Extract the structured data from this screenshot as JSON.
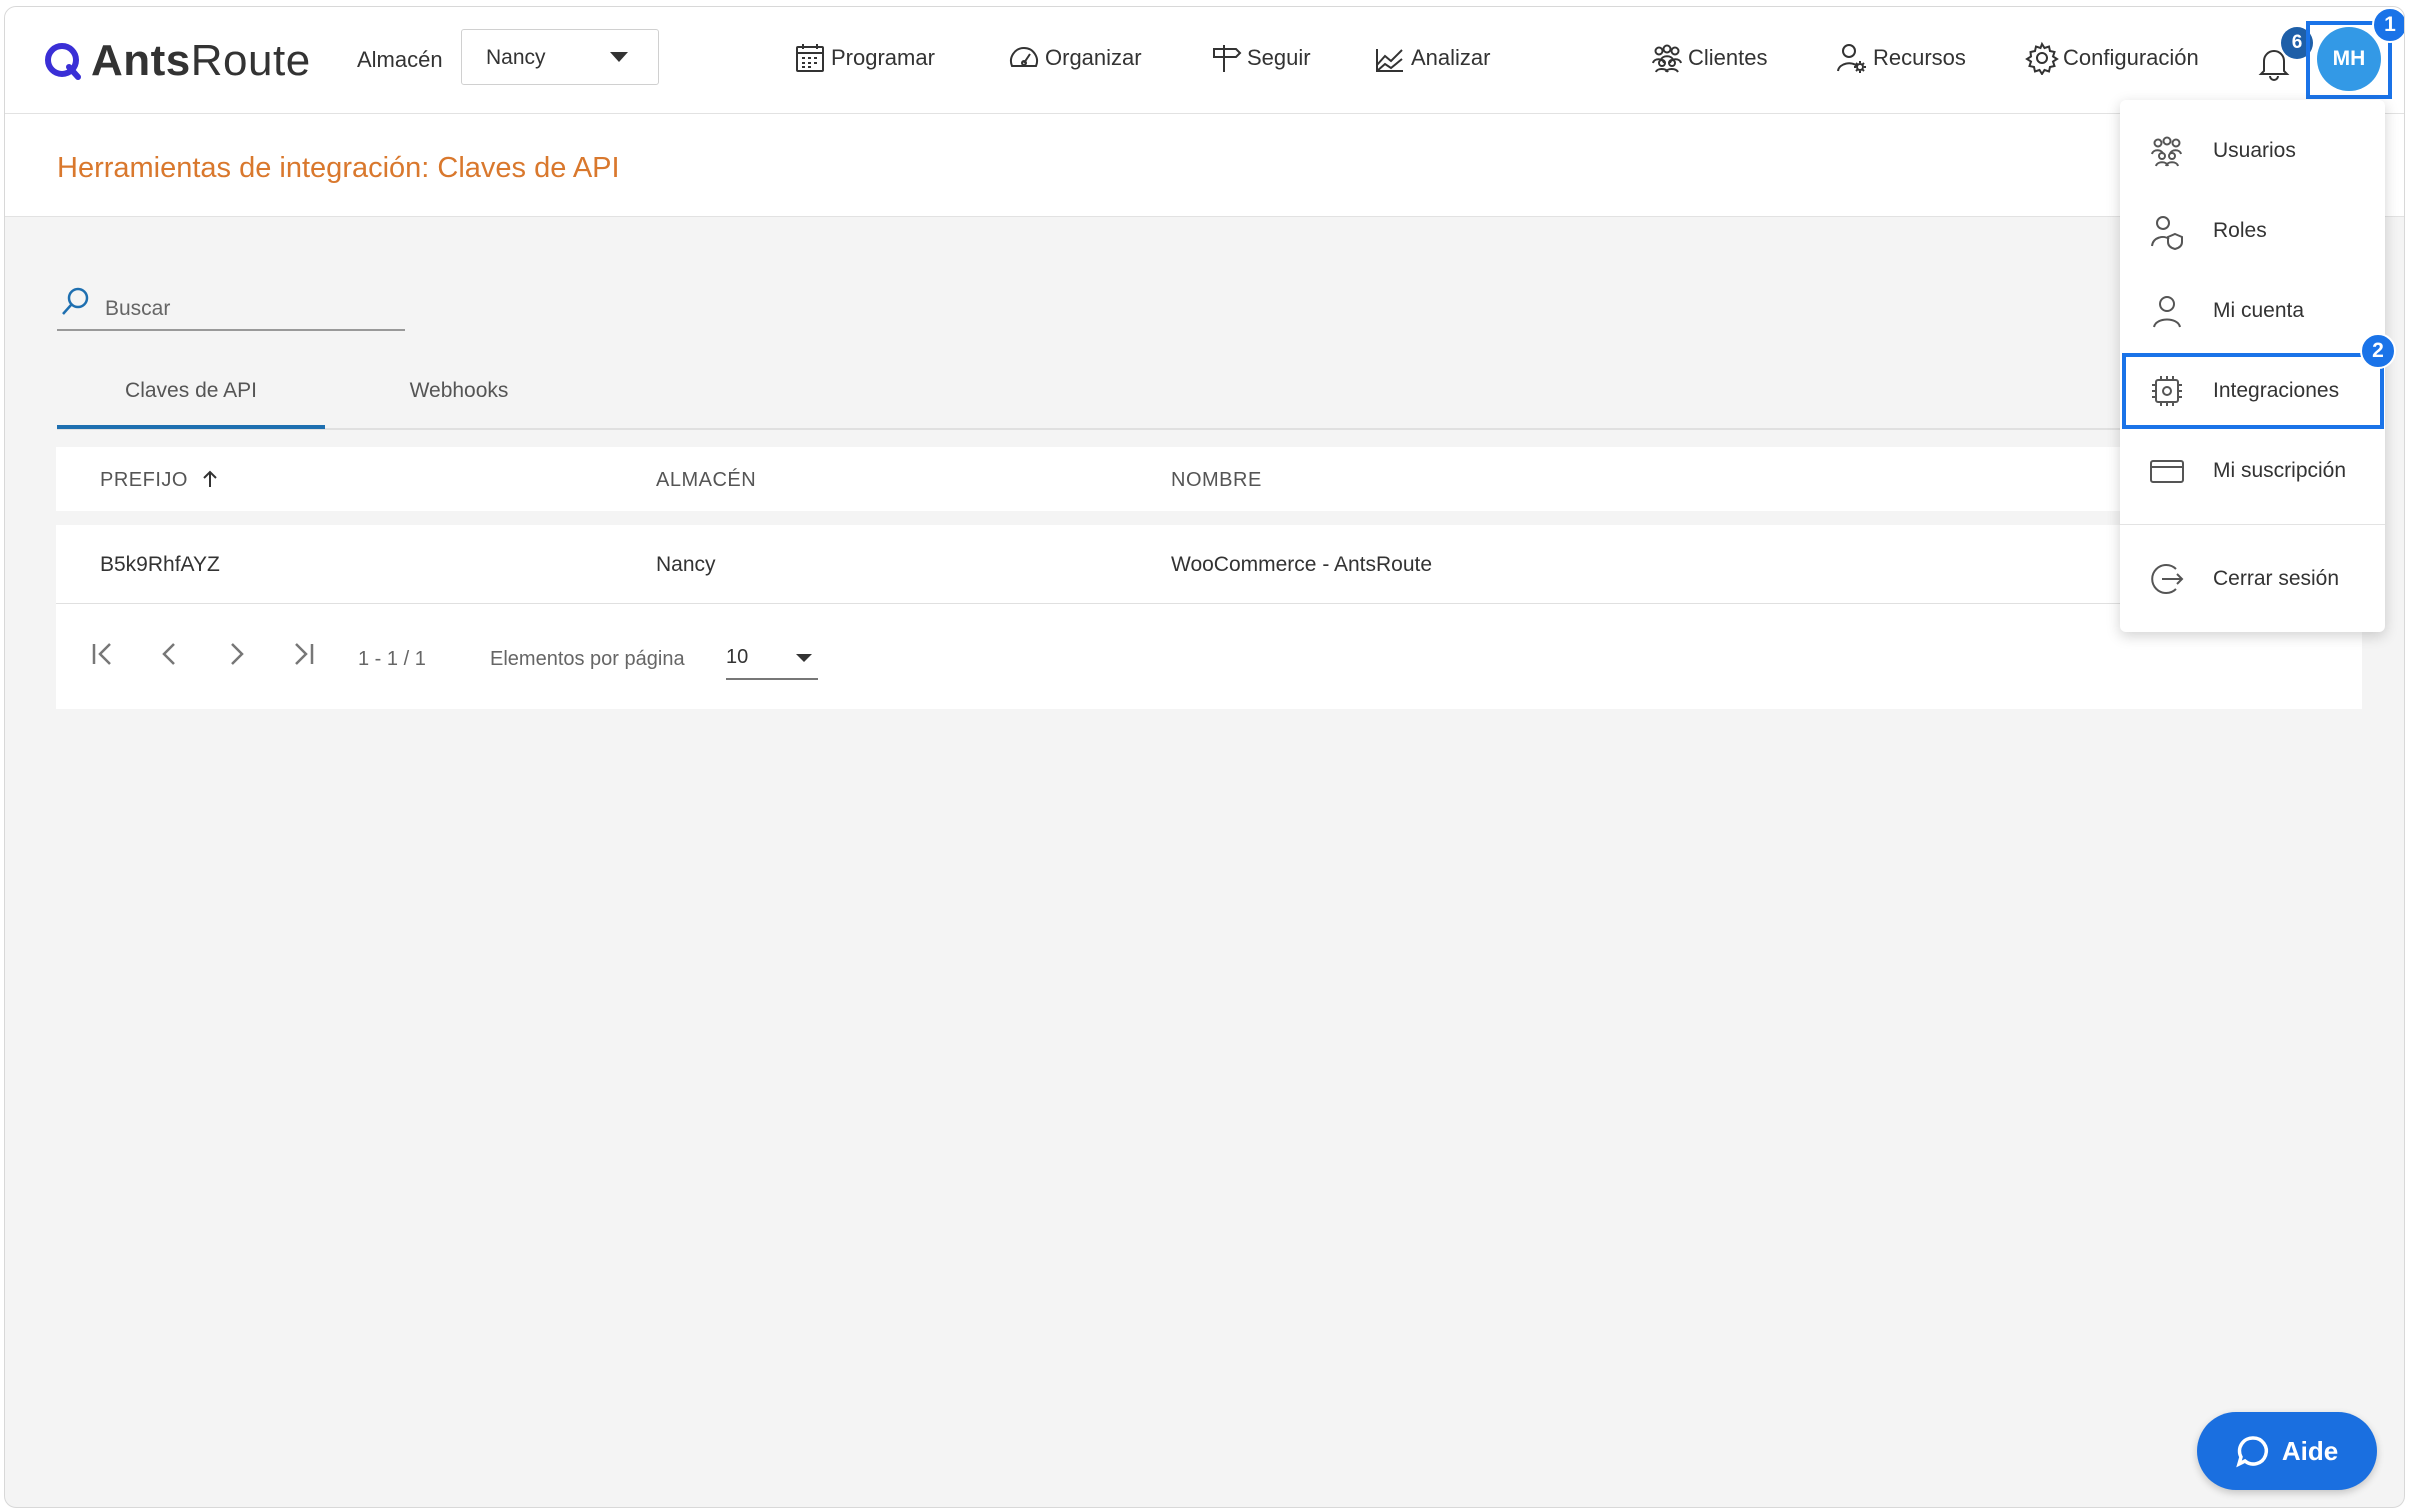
{
  "brand": {
    "logo_bold": "Ants",
    "logo_regular": "Route",
    "accent": "#3a2fd6"
  },
  "header": {
    "warehouse_label": "Almacén",
    "warehouse_value": "Nancy",
    "nav": {
      "schedule": "Programar",
      "organize": "Organizar",
      "track": "Seguir",
      "analyze": "Analizar",
      "clients": "Clientes",
      "resources": "Recursos",
      "settings": "Configuración"
    },
    "notification_count": "6",
    "avatar_initials": "MH"
  },
  "page": {
    "title": "Herramientas de integración: Claves de API",
    "title_color": "#d9782d",
    "search_placeholder": "Buscar",
    "tabs": {
      "api_keys": "Claves de API",
      "webhooks": "Webhooks"
    }
  },
  "table": {
    "headers": {
      "prefix": "PREFIJO",
      "warehouse": "ALMACÉN",
      "name": "NOMBRE"
    },
    "rows": [
      {
        "prefix": "B5k9RhfAYZ",
        "warehouse": "Nancy",
        "name": "WooCommerce - AntsRoute"
      }
    ],
    "pagination": {
      "range": "1 - 1 / 1",
      "per_page_label": "Elementos por página",
      "per_page_value": "10"
    }
  },
  "user_menu": {
    "users": "Usuarios",
    "roles": "Roles",
    "my_account": "Mi cuenta",
    "integrations": "Integraciones",
    "subscription": "Mi suscripción",
    "logout": "Cerrar sesión"
  },
  "annotations": {
    "step1": "1",
    "step2": "2",
    "highlight_color": "#1a73e8"
  },
  "help_button": "Aide"
}
